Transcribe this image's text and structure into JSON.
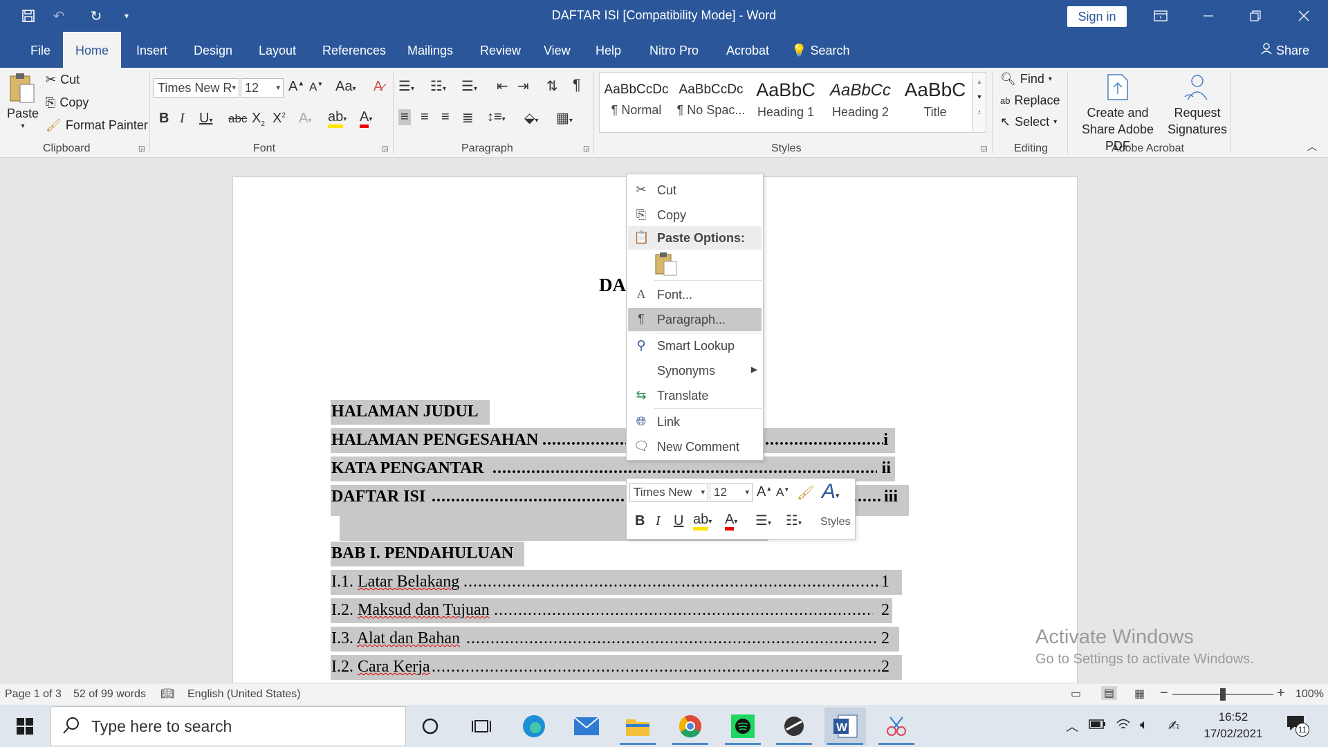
{
  "titlebar": {
    "title": "DAFTAR ISI [Compatibility Mode]  -  Word",
    "sign_in": "Sign in"
  },
  "tabs": [
    "File",
    "Home",
    "Insert",
    "Design",
    "Layout",
    "References",
    "Mailings",
    "Review",
    "View",
    "Help",
    "Nitro Pro",
    "Acrobat"
  ],
  "tell_me": "Search",
  "share": "Share",
  "ribbon": {
    "clipboard": {
      "paste": "Paste",
      "cut": "Cut",
      "copy": "Copy",
      "format_painter": "Format Painter",
      "label": "Clipboard"
    },
    "font": {
      "name": "Times New R",
      "size": "12",
      "label": "Font"
    },
    "paragraph": {
      "label": "Paragraph"
    },
    "styles": {
      "label": "Styles",
      "items": [
        {
          "preview": "AaBbCcDc",
          "name": "¶ Normal"
        },
        {
          "preview": "AaBbCcDc",
          "name": "¶ No Spac..."
        },
        {
          "preview": "AaBbC",
          "name": "Heading 1"
        },
        {
          "preview": "AaBbCc",
          "name": "Heading 2"
        },
        {
          "preview": "AaBbC",
          "name": "Title"
        }
      ]
    },
    "editing": {
      "find": "Find",
      "replace": "Replace",
      "select": "Select",
      "label": "Editing"
    },
    "acrobat": {
      "create_share": "Create and Share Adobe PDF",
      "request_sig": "Request Signatures",
      "label": "Adobe Acrobat"
    }
  },
  "document": {
    "title_partial": "DA",
    "lines": [
      {
        "text": "HALAMAN JUDUL",
        "bold": true
      },
      {
        "text": "HALAMAN PENGESAHAN",
        "bold": true,
        "page": "i"
      },
      {
        "text": "KATA PENGANTAR",
        "bold": true,
        "page": "ii"
      },
      {
        "text": "DAFTAR ISI",
        "bold": true,
        "page": "iii"
      },
      {
        "text": "BAB I. PENDAHULUAN",
        "bold": true
      },
      {
        "num": "I.1.",
        "text": "Latar Belakang",
        "page": "1"
      },
      {
        "num": "I.2.",
        "text": "Maksud dan Tujuan",
        "page": "2"
      },
      {
        "num": "I.3.",
        "text": "Alat dan Bahan",
        "page": "2"
      },
      {
        "num": "I.2.",
        "text": "Cara Kerja",
        "page": "2"
      }
    ]
  },
  "context_menu": {
    "items": [
      "Cut",
      "Copy",
      "Paste Options:",
      "Font...",
      "Paragraph...",
      "Smart Lookup",
      "Synonyms",
      "Translate",
      "Link",
      "New Comment"
    ]
  },
  "mini_toolbar": {
    "font": "Times New",
    "size": "12",
    "styles": "Styles"
  },
  "statusbar": {
    "page": "Page 1 of 3",
    "words": "52 of 99 words",
    "language": "English (United States)",
    "zoom": "100%"
  },
  "watermark": {
    "line1": "Activate Windows",
    "line2": "Go to Settings to activate Windows."
  },
  "taskbar": {
    "search_placeholder": "Type here to search",
    "time": "16:52",
    "date": "17/02/2021",
    "notifications": "11"
  }
}
